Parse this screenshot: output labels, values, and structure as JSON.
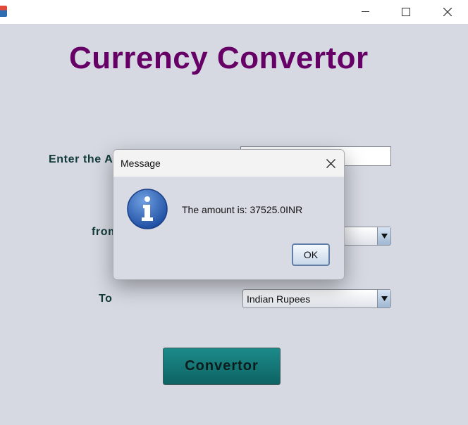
{
  "window": {
    "app_icon": "java-coffee-icon",
    "controls": [
      "minimize-icon",
      "maximize-icon",
      "close-icon"
    ]
  },
  "main": {
    "title": "Currency Convertor",
    "amount_label": "Enter the A",
    "from_label": "from",
    "to_label": "To",
    "to_selected": "Indian Rupees",
    "convert_button": "Convertor"
  },
  "dialog": {
    "title": "Message",
    "message": "The amount is: 37525.0INR",
    "ok_label": "OK",
    "icon": "information-icon"
  },
  "colors": {
    "background": "#d6d9e2",
    "heading": "#660066",
    "button_teal": "#0d6363",
    "info_blue": "#2a5db0"
  }
}
